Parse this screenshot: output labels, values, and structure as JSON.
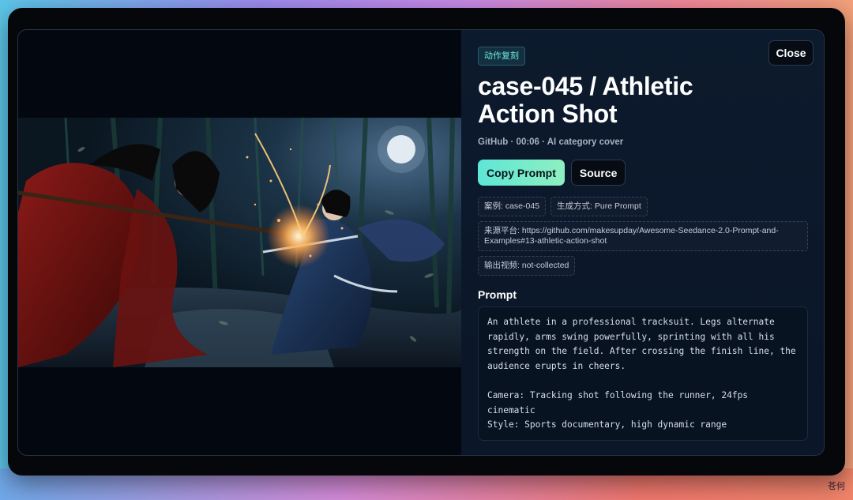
{
  "modal": {
    "category_badge": "动作复刻",
    "close_label": "Close",
    "title": "case-045 / Athletic Action Shot",
    "meta": "GitHub · 00:06 · AI category cover",
    "copy_prompt_label": "Copy Prompt",
    "source_label": "Source",
    "tags": {
      "case": "案例: case-045",
      "method": "生成方式: Pure Prompt",
      "source_platform": "来源平台: https://github.com/makesupday/Awesome-Seedance-2.0-Prompt-and-Examples#13-athletic-action-shot",
      "output_video": "输出视频: not-collected"
    },
    "prompt_heading": "Prompt",
    "prompt_text": "An athlete in a professional tracksuit. Legs alternate rapidly, arms swing powerfully, sprinting with all his strength on the field. After crossing the finish line, the audience erupts in cheers.\n\nCamera: Tracking shot following the runner, 24fps cinematic\nStyle: Sports documentary, high dynamic range"
  },
  "watermark": "苍何",
  "colors": {
    "accent": "#5ee6d6",
    "panel": "#0c1a2d",
    "frame": "#06070b"
  }
}
